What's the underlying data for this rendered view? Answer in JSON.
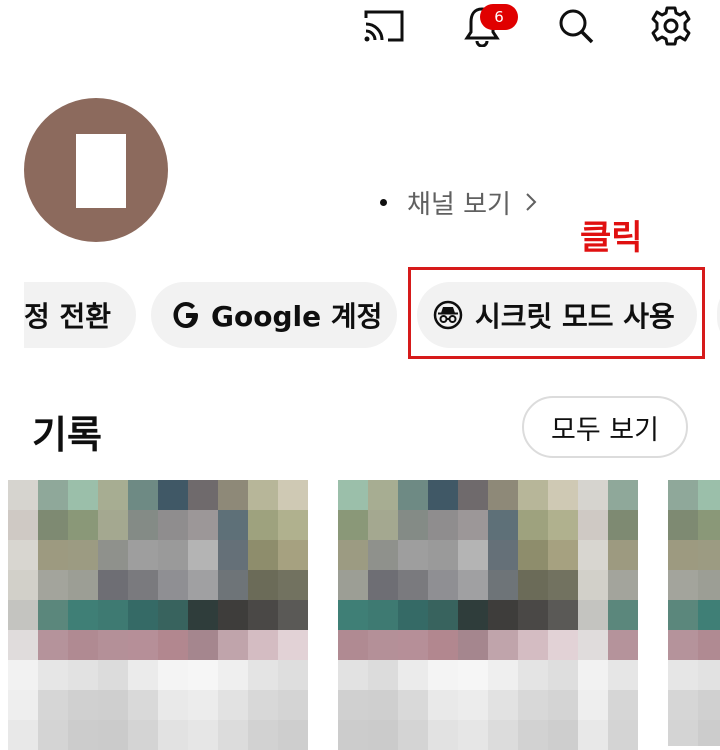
{
  "topbar": {
    "notification_count": "6",
    "icons": [
      "cast-icon",
      "bell-icon",
      "search-icon",
      "settings-icon"
    ]
  },
  "profile": {
    "channel_link": "채널 보기"
  },
  "annotation": {
    "label": "클릭",
    "color": "#e01010"
  },
  "chips": [
    {
      "label": "정 전환"
    },
    {
      "label": "Google 계정"
    },
    {
      "label": "시크릿 모드 사용"
    }
  ],
  "history": {
    "title": "기록",
    "view_all_label": "모두 보기"
  }
}
